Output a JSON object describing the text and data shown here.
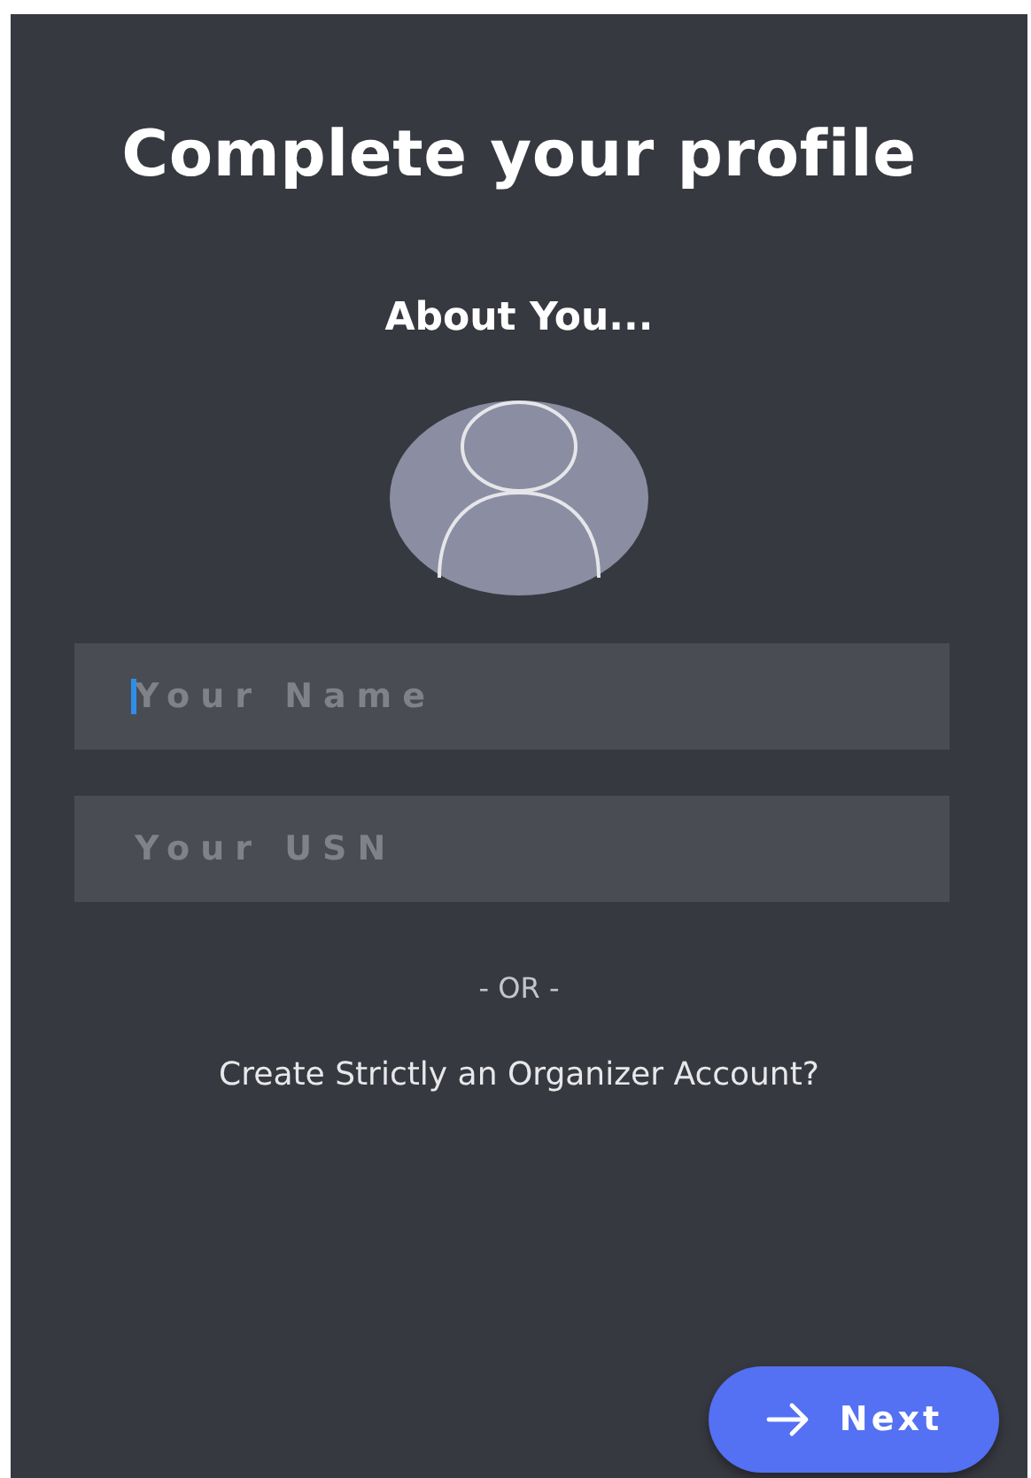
{
  "title": "Complete your profile",
  "subtitle": "About You...",
  "fields": [
    {
      "placeholder": "Your Name",
      "focused": true
    },
    {
      "placeholder": "Your USN",
      "focused": false
    }
  ],
  "separator": "- OR -",
  "organizer_link": "Create Strictly an Organizer Account?",
  "next_button": "Next"
}
